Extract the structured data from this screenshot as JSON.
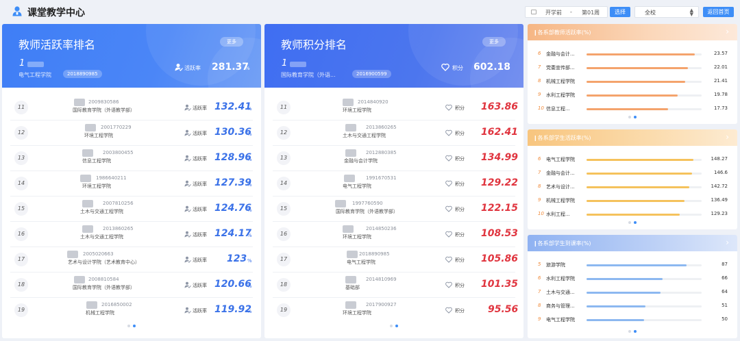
{
  "app": {
    "title": "课堂教学中心"
  },
  "toolbar": {
    "start_label": "开学前",
    "separator": "-",
    "end_label": "第01周",
    "choose_label": "选择",
    "scope_value": "全校",
    "home_label": "返回首页"
  },
  "activity_panel": {
    "title": "教师活跃率排名",
    "more_label": "更多",
    "top": {
      "rank": "1",
      "dept": "电气工程学院",
      "id": "2018890985",
      "label": "活跃率",
      "value": "281.37",
      "unit": "%"
    },
    "rows": [
      {
        "rank": "11",
        "id": "2009830586",
        "dept": "国际教育学院（外语教学部）",
        "label": "活跃率",
        "value": "132.41",
        "unit": "%"
      },
      {
        "rank": "12",
        "id": "2001770229",
        "dept": "环境工程学院",
        "label": "活跃率",
        "value": "130.36",
        "unit": "%"
      },
      {
        "rank": "13",
        "id": "2003800455",
        "dept": "信息工程学院",
        "label": "活跃率",
        "value": "128.96",
        "unit": "%"
      },
      {
        "rank": "14",
        "id": "1986640211",
        "dept": "环境工程学院",
        "label": "活跃率",
        "value": "127.39",
        "unit": "%"
      },
      {
        "rank": "15",
        "id": "2007810256",
        "dept": "土木与交通工程学院",
        "label": "活跃率",
        "value": "124.76",
        "unit": "%"
      },
      {
        "rank": "16",
        "id": "2013860265",
        "dept": "土木与交通工程学院",
        "label": "活跃率",
        "value": "124.17",
        "unit": "%"
      },
      {
        "rank": "17",
        "id": "2005020663",
        "dept": "艺术与设计学院（艺术教育中心）",
        "label": "活跃率",
        "value": "123",
        "unit": "%"
      },
      {
        "rank": "18",
        "id": "2008810584",
        "dept": "国际教育学院（外语教学部）",
        "label": "活跃率",
        "value": "120.66",
        "unit": "%"
      },
      {
        "rank": "19",
        "id": "2016850002",
        "dept": "机械工程学院",
        "label": "活跃率",
        "value": "119.92",
        "unit": "%"
      }
    ]
  },
  "points_panel": {
    "title": "教师积分排名",
    "more_label": "更多",
    "top": {
      "rank": "1",
      "dept": "国际教育学院（外语...",
      "id": "2016900599",
      "label": "积分",
      "value": "602.18"
    },
    "rows": [
      {
        "rank": "11",
        "id": "2014840920",
        "dept": "环境工程学院",
        "label": "积分",
        "value": "163.86"
      },
      {
        "rank": "12",
        "id": "2013860265",
        "dept": "土木与交通工程学院",
        "label": "积分",
        "value": "162.41"
      },
      {
        "rank": "13",
        "id": "2012880385",
        "dept": "金融与会计学院",
        "label": "积分",
        "value": "134.99"
      },
      {
        "rank": "14",
        "id": "1991670531",
        "dept": "电气工程学院",
        "label": "积分",
        "value": "129.22"
      },
      {
        "rank": "15",
        "id": "1997760590",
        "dept": "国际教育学院（外语教学部）",
        "label": "积分",
        "value": "122.15"
      },
      {
        "rank": "16",
        "id": "2014850236",
        "dept": "环境工程学院",
        "label": "积分",
        "value": "108.53"
      },
      {
        "rank": "17",
        "id": "2018890985",
        "dept": "电气工程学院",
        "label": "积分",
        "value": "105.86"
      },
      {
        "rank": "18",
        "id": "2014810969",
        "dept": "基础部",
        "label": "积分",
        "value": "101.35"
      },
      {
        "rank": "19",
        "id": "2017900927",
        "dept": "环境工程学院",
        "label": "积分",
        "value": "95.56"
      }
    ]
  },
  "dept_teacher_activity": {
    "title": "各系部教师活跃率(%)",
    "max": 25,
    "rows": [
      {
        "rank": "6",
        "name": "金融与会计...",
        "value": 23.57,
        "label": "23.57"
      },
      {
        "rank": "7",
        "name": "党委宣传部...",
        "value": 22.01,
        "label": "22.01"
      },
      {
        "rank": "8",
        "name": "机械工程学院",
        "value": 21.41,
        "label": "21.41"
      },
      {
        "rank": "9",
        "name": "水利工程学院",
        "value": 19.78,
        "label": "19.78"
      },
      {
        "rank": "10",
        "name": "信息工程...",
        "value": 17.73,
        "label": "17.73"
      }
    ]
  },
  "dept_student_activity": {
    "title": "各系部学生活跃率(%)",
    "max": 160,
    "rows": [
      {
        "rank": "6",
        "name": "电气工程学院",
        "value": 148.27,
        "label": "148.27"
      },
      {
        "rank": "7",
        "name": "金融与会计...",
        "value": 146.6,
        "label": "146.6"
      },
      {
        "rank": "8",
        "name": "艺术与设计...",
        "value": 142.72,
        "label": "142.72"
      },
      {
        "rank": "9",
        "name": "机械工程学院",
        "value": 136.49,
        "label": "136.49"
      },
      {
        "rank": "10",
        "name": "水利工程...",
        "value": 129.23,
        "label": "129.23"
      }
    ]
  },
  "dept_student_attendance": {
    "title": "各系部学生到课率(%)",
    "max": 100,
    "rows": [
      {
        "rank": "5",
        "name": "旅游学院",
        "value": 87,
        "label": "87"
      },
      {
        "rank": "6",
        "name": "水利工程学院",
        "value": 66,
        "label": "66"
      },
      {
        "rank": "7",
        "name": "土木与交通...",
        "value": 64,
        "label": "64"
      },
      {
        "rank": "8",
        "name": "商务与管理...",
        "value": 51,
        "label": "51"
      },
      {
        "rank": "9",
        "name": "电气工程学院",
        "value": 50,
        "label": "50"
      }
    ]
  }
}
